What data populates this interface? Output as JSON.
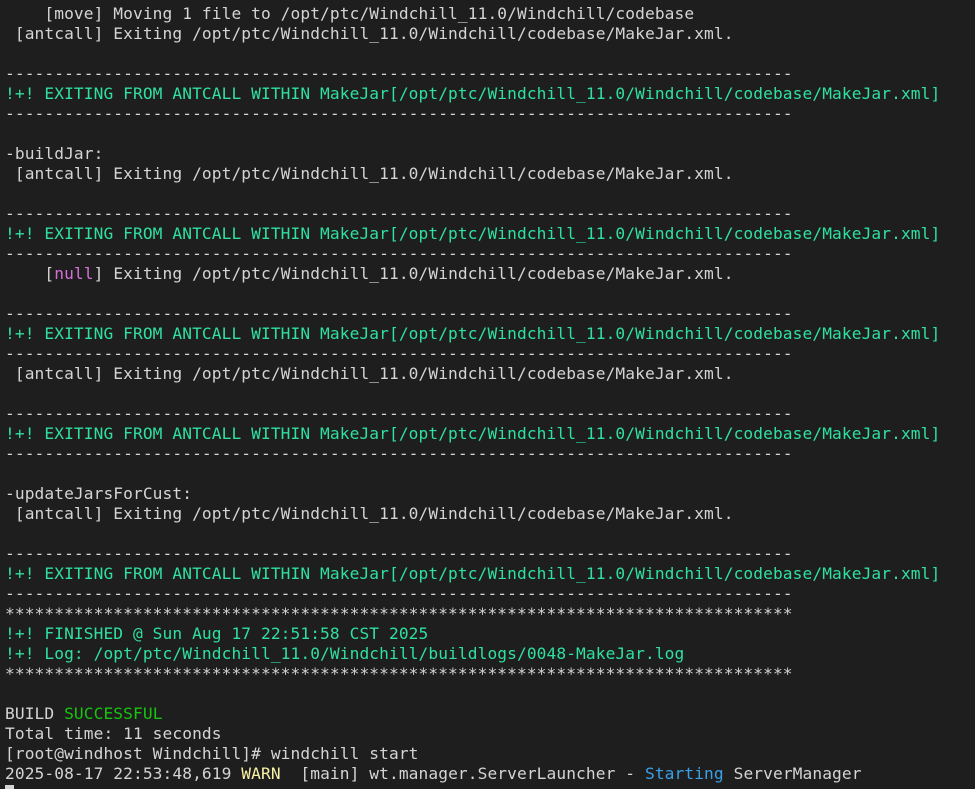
{
  "colors": {
    "background": "#1e1e1e",
    "default": "#d4d4d4",
    "green": "#16c60c",
    "teal": "#2fe0a0",
    "magenta": "#d670d6",
    "yellow": "#f9f1a5",
    "cyan": "#3aa0e8"
  },
  "terminal": {
    "lines": [
      [
        [
          "default",
          "    [move] Moving 1 file to /opt/ptc/Windchill_11.0/Windchill/codebase"
        ]
      ],
      [
        [
          "default",
          " [antcall] Exiting /opt/ptc/Windchill_11.0/Windchill/codebase/MakeJar.xml."
        ]
      ],
      [
        [
          "default",
          ""
        ]
      ],
      [
        [
          "default",
          "--------------------------------------------------------------------------------"
        ]
      ],
      [
        [
          "teal",
          "!+! EXITING FROM ANTCALL WITHIN MakeJar[/opt/ptc/Windchill_11.0/Windchill/codebase/MakeJar.xml]"
        ]
      ],
      [
        [
          "default",
          "--------------------------------------------------------------------------------"
        ]
      ],
      [
        [
          "default",
          ""
        ]
      ],
      [
        [
          "default",
          "-buildJar:"
        ]
      ],
      [
        [
          "default",
          " [antcall] Exiting /opt/ptc/Windchill_11.0/Windchill/codebase/MakeJar.xml."
        ]
      ],
      [
        [
          "default",
          ""
        ]
      ],
      [
        [
          "default",
          "--------------------------------------------------------------------------------"
        ]
      ],
      [
        [
          "teal",
          "!+! EXITING FROM ANTCALL WITHIN MakeJar[/opt/ptc/Windchill_11.0/Windchill/codebase/MakeJar.xml]"
        ]
      ],
      [
        [
          "default",
          "--------------------------------------------------------------------------------"
        ]
      ],
      [
        [
          "default",
          "    ["
        ],
        [
          "magenta",
          "null"
        ],
        [
          "default",
          "] Exiting /opt/ptc/Windchill_11.0/Windchill/codebase/MakeJar.xml."
        ]
      ],
      [
        [
          "default",
          ""
        ]
      ],
      [
        [
          "default",
          "--------------------------------------------------------------------------------"
        ]
      ],
      [
        [
          "teal",
          "!+! EXITING FROM ANTCALL WITHIN MakeJar[/opt/ptc/Windchill_11.0/Windchill/codebase/MakeJar.xml]"
        ]
      ],
      [
        [
          "default",
          "--------------------------------------------------------------------------------"
        ]
      ],
      [
        [
          "default",
          " [antcall] Exiting /opt/ptc/Windchill_11.0/Windchill/codebase/MakeJar.xml."
        ]
      ],
      [
        [
          "default",
          ""
        ]
      ],
      [
        [
          "default",
          "--------------------------------------------------------------------------------"
        ]
      ],
      [
        [
          "teal",
          "!+! EXITING FROM ANTCALL WITHIN MakeJar[/opt/ptc/Windchill_11.0/Windchill/codebase/MakeJar.xml]"
        ]
      ],
      [
        [
          "default",
          "--------------------------------------------------------------------------------"
        ]
      ],
      [
        [
          "default",
          ""
        ]
      ],
      [
        [
          "default",
          "-updateJarsForCust:"
        ]
      ],
      [
        [
          "default",
          " [antcall] Exiting /opt/ptc/Windchill_11.0/Windchill/codebase/MakeJar.xml."
        ]
      ],
      [
        [
          "default",
          ""
        ]
      ],
      [
        [
          "default",
          "--------------------------------------------------------------------------------"
        ]
      ],
      [
        [
          "teal",
          "!+! EXITING FROM ANTCALL WITHIN MakeJar[/opt/ptc/Windchill_11.0/Windchill/codebase/MakeJar.xml]"
        ]
      ],
      [
        [
          "default",
          "--------------------------------------------------------------------------------"
        ]
      ],
      [
        [
          "default",
          "********************************************************************************"
        ]
      ],
      [
        [
          "teal",
          "!+! FINISHED @ Sun Aug 17 22:51:58 CST 2025"
        ]
      ],
      [
        [
          "teal",
          "!+! Log: /opt/ptc/Windchill_11.0/Windchill/buildlogs/0048-MakeJar.log"
        ]
      ],
      [
        [
          "default",
          "********************************************************************************"
        ]
      ],
      [
        [
          "default",
          ""
        ]
      ],
      [
        [
          "default",
          "BUILD "
        ],
        [
          "green",
          "SUCCESSFUL"
        ]
      ],
      [
        [
          "default",
          "Total time: 11 seconds"
        ]
      ],
      [
        [
          "default",
          "[root@windhost Windchill]# windchill start"
        ]
      ],
      [
        [
          "default",
          "2025-08-17 22:53:48,619 "
        ],
        [
          "yellow",
          "WARN"
        ],
        [
          "default",
          "  [main] wt.manager.ServerLauncher - "
        ],
        [
          "cyan",
          "Starting"
        ],
        [
          "default",
          " ServerManager"
        ]
      ],
      [
        [
          "default",
          ""
        ]
      ]
    ]
  }
}
